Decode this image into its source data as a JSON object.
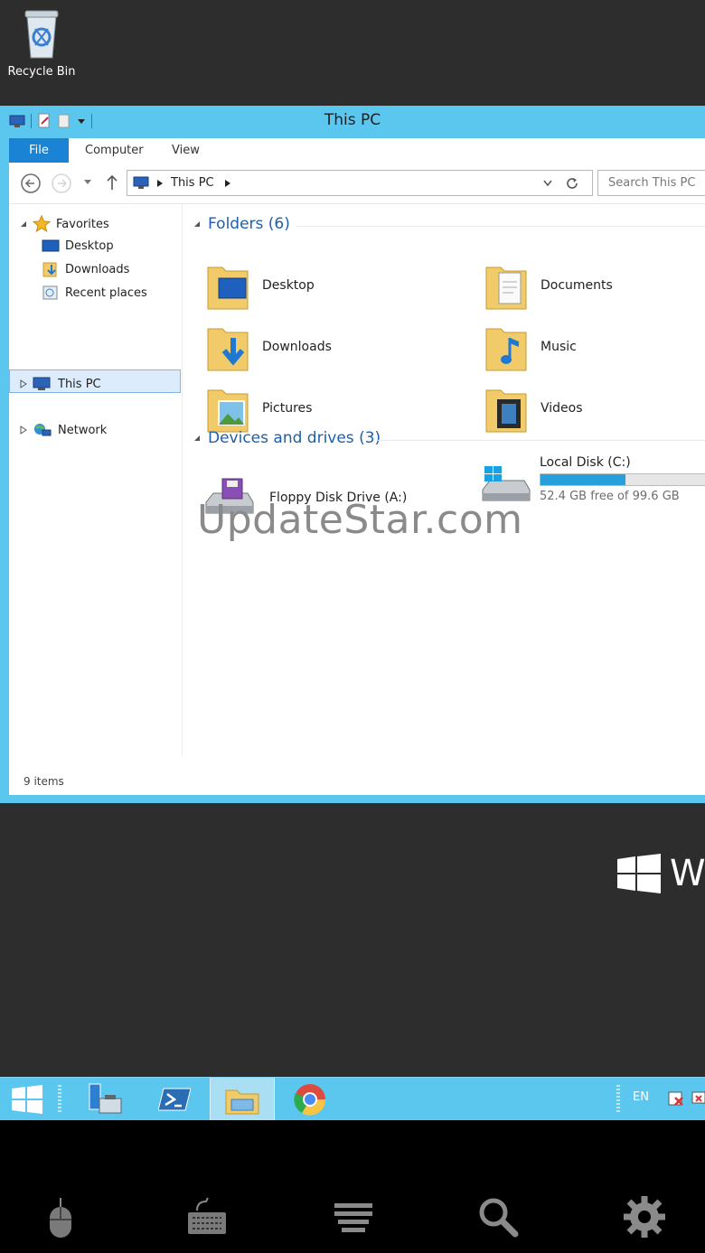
{
  "desktop": {
    "recycle_bin_label": "Recycle Bin",
    "watermark": "UpdateStar.com",
    "brand_letter": "W"
  },
  "window": {
    "title": "This PC",
    "ribbon_tabs": [
      "File",
      "Computer",
      "View"
    ],
    "address": {
      "crumb": "This PC",
      "search_placeholder": "Search This PC"
    },
    "nav": {
      "favorites": "Favorites",
      "desktop": "Desktop",
      "downloads": "Downloads",
      "recent": "Recent places",
      "this_pc": "This PC",
      "network": "Network"
    },
    "folders_header": "Folders (6)",
    "folders": [
      "Desktop",
      "Documents",
      "Downloads",
      "Music",
      "Pictures",
      "Videos"
    ],
    "devices_header": "Devices and drives (3)",
    "drives": {
      "floppy": "Floppy Disk Drive (A:)",
      "local_name": "Local Disk (C:)",
      "local_free": "52.4 GB free of 99.6 GB",
      "local_used_fraction": 0.474
    },
    "status": "9 items"
  },
  "taskbar": {
    "lang": "EN"
  }
}
